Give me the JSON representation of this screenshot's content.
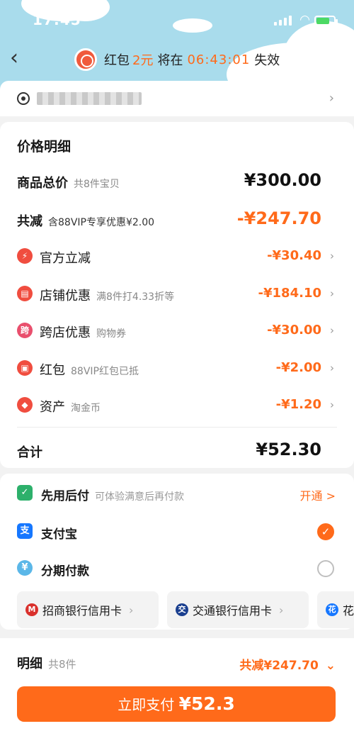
{
  "status": {
    "time": "17:45"
  },
  "nav": {
    "prefix": "红包",
    "amount": "2元",
    "will": "将在",
    "countdown": "06:43:01",
    "suffix": "失效"
  },
  "price": {
    "title": "价格明细",
    "total_label": "商品总价",
    "total_sub": "共8件宝贝",
    "total_amount": "¥300.00",
    "reduce_label": "共减",
    "reduce_sub": "含88VIP专享优惠¥2.00",
    "reduce_amount": "-¥247.70",
    "items": [
      {
        "label": "官方立减",
        "sub": "",
        "amount": "-¥30.40",
        "icon": "lightning-icon",
        "glyph": "⚡",
        "color": "#f04d3f"
      },
      {
        "label": "店铺优惠",
        "sub": "满8件打4.33折等",
        "amount": "-¥184.10",
        "icon": "shop-icon",
        "glyph": "▤",
        "color": "#f04d3f"
      },
      {
        "label": "跨店优惠",
        "sub": "购物券",
        "amount": "-¥30.00",
        "icon": "cross-store-icon",
        "glyph": "跨",
        "color": "#e94f6d"
      },
      {
        "label": "红包",
        "sub": "88VIP红包已抵",
        "amount": "-¥2.00",
        "icon": "red-packet-icon",
        "glyph": "▣",
        "color": "#f04d3f"
      },
      {
        "label": "资产",
        "sub": "淘金币",
        "amount": "-¥1.20",
        "icon": "tag-icon",
        "glyph": "◆",
        "color": "#f04d3f"
      }
    ],
    "sum_label": "合计",
    "sum_amount": "¥52.30"
  },
  "payment": {
    "later_label": "先用后付",
    "later_sub": "可体验满意后再付款",
    "later_action": "开通 >",
    "alipay_label": "支付宝",
    "installment_label": "分期付款",
    "cards": [
      "招商银行信用卡",
      "交通银行信用卡",
      "花"
    ]
  },
  "bottom": {
    "detail_label": "明细",
    "detail_sub": "共8件",
    "detail_reduce": "共减¥247.70",
    "pay_label": "立即支付",
    "pay_amount": "¥52.3"
  },
  "colors": {
    "accent": "#ff6a1a",
    "header_bg": "#a9dcec",
    "icon_red": "#f04d3f"
  }
}
